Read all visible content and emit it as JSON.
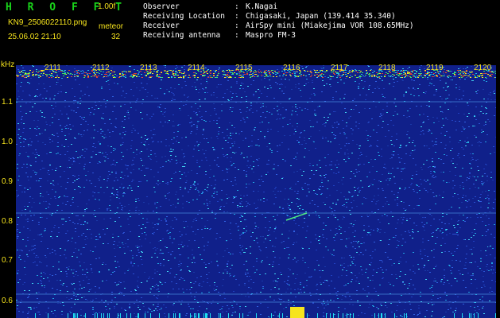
{
  "header": {
    "brand": "H R O F F T",
    "version": "1.00f",
    "filename": "KN9_2506022110.png",
    "mode": "meteor",
    "timestamp": "25.06.02 21:10",
    "count": "32"
  },
  "info": [
    {
      "key": "Observer",
      "sep": ":",
      "value": "K.Nagai"
    },
    {
      "key": "Receiving Location",
      "sep": ":",
      "value": "Chigasaki, Japan (139.414 35.340)"
    },
    {
      "key": "Receiver",
      "sep": ":",
      "value": "AirSpy mini (Miakejima VOR 108.65MHz)"
    },
    {
      "key": "Receiving antenna",
      "sep": ":",
      "value": "Maspro FM-3"
    }
  ],
  "axis": {
    "y_unit": "kHz",
    "y_ticks": [
      "1.1",
      "1.0",
      "0.9",
      "0.8",
      "0.7",
      "0.6"
    ],
    "x_ticks": [
      "2111",
      "2112",
      "2113",
      "2114",
      "2115",
      "2116",
      "2117",
      "2118",
      "2119",
      "2120"
    ]
  },
  "colors": {
    "background": "#10208a",
    "label": "#f6e41d",
    "brand": "#19d31a"
  }
}
